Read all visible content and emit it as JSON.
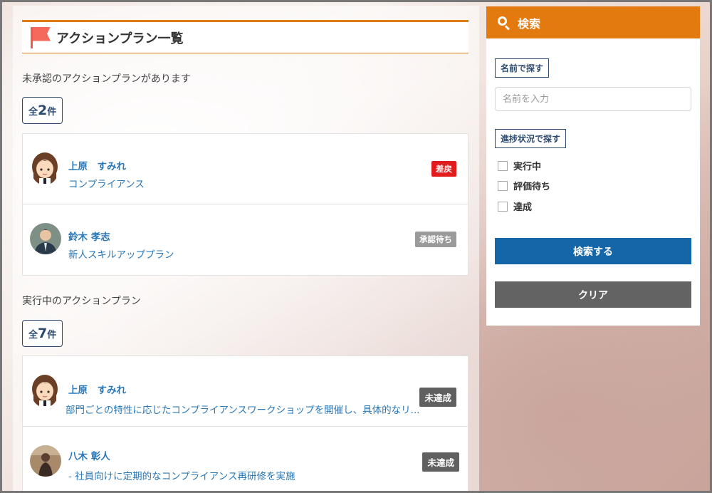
{
  "header": {
    "title": "アクションプラン一覧"
  },
  "pending": {
    "label": "未承認のアクションプランがあります",
    "count_prefix": "全",
    "count": "2",
    "count_suffix": "件",
    "items": [
      {
        "name": "上原　すみれ",
        "plan": "コンプライアンス",
        "badge": "差戻"
      },
      {
        "name": "鈴木 孝志",
        "plan": "新人スキルアッププラン",
        "badge": "承認待ち"
      }
    ]
  },
  "active": {
    "label": "実行中のアクションプラン",
    "count_prefix": "全",
    "count": "7",
    "count_suffix": "件",
    "items": [
      {
        "name": "上原　すみれ",
        "plan": "部門ごとの特性に応じたコンプライアンスワークショップを開催し、具体的なリ...",
        "badge": "未達成"
      },
      {
        "name": "八木 彰人",
        "plan": "- 社員向けに定期的なコンプライアンス再研修を実施",
        "badge": "未達成"
      }
    ]
  },
  "search": {
    "title": "検索",
    "name_section": "名前で探す",
    "name_placeholder": "名前を入力",
    "status_section": "進捗状況で探す",
    "statuses": [
      "実行中",
      "評価待ち",
      "達成"
    ],
    "submit": "検索する",
    "clear": "クリア"
  },
  "colors": {
    "accent": "#e27a0f",
    "primary": "#1466a8",
    "link": "#2a78b8",
    "danger": "#e21c1c"
  }
}
